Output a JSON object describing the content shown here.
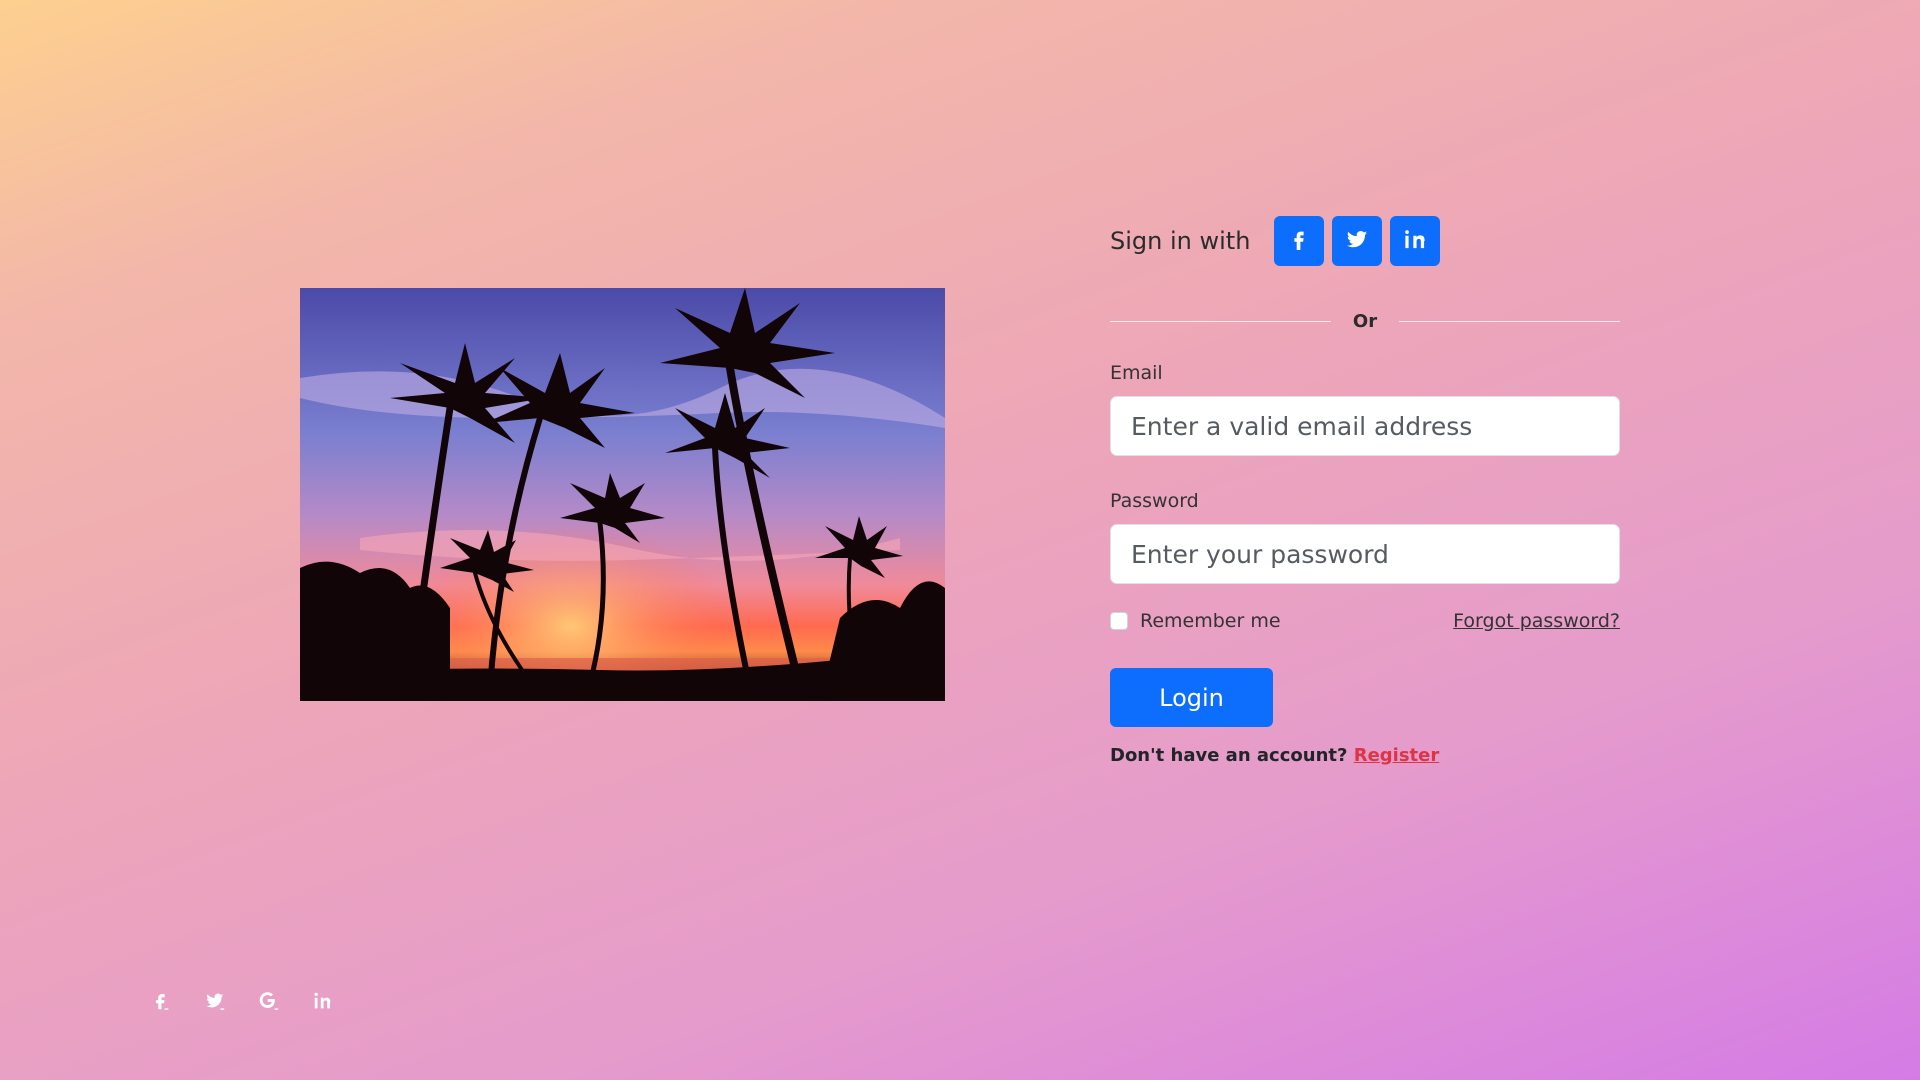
{
  "photo": {
    "alt": "Palm trees silhouetted against a sunset sky over water"
  },
  "signin": {
    "label": "Sign in with",
    "buttons": [
      {
        "icon": "facebook-icon"
      },
      {
        "icon": "twitter-icon"
      },
      {
        "icon": "linkedin-icon"
      }
    ]
  },
  "divider": {
    "text": "Or"
  },
  "email": {
    "label": "Email",
    "placeholder": "Enter a valid email address",
    "value": ""
  },
  "password": {
    "label": "Password",
    "placeholder": "Enter your password",
    "value": ""
  },
  "remember": {
    "label": "Remember me",
    "checked": false
  },
  "forgot": {
    "label": "Forgot password?"
  },
  "login": {
    "label": "Login"
  },
  "register": {
    "prompt": "Don't have an account? ",
    "link": "Register"
  },
  "footer": {
    "icons": [
      "facebook-icon",
      "twitter-icon",
      "google-icon",
      "linkedin-icon"
    ]
  },
  "colors": {
    "primary": "#0d6efd",
    "register_link": "#dc3545",
    "gradient_start": "#fdd08f",
    "gradient_end": "#d57be6"
  }
}
